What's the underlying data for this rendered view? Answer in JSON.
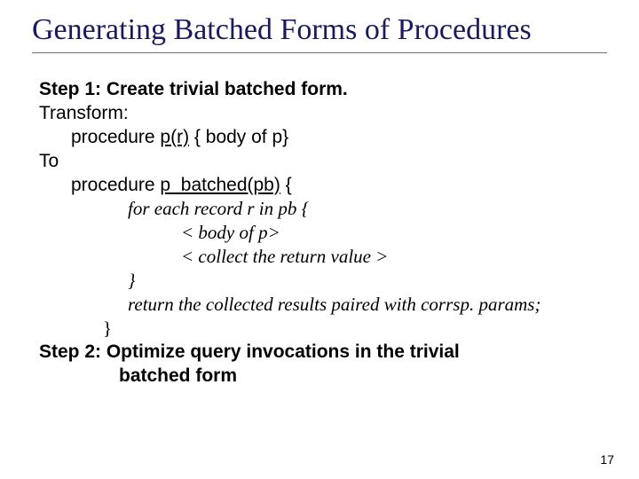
{
  "title": "Generating Batched Forms of Procedures",
  "body": {
    "step1_heading": "Step 1: Create trivial batched form.",
    "transform_label": "Transform:",
    "proc_orig_prefix": "procedure ",
    "proc_orig_sig": "p(r)",
    "proc_orig_suffix": " { body of p}",
    "to_label": "To",
    "proc_batched_prefix": "procedure ",
    "proc_batched_sig": "p_batched(pb)",
    "proc_batched_suffix": " {",
    "foreach_line": "for each record r in pb {",
    "body_of_p_line": "< body of p>",
    "collect_line": "< collect the return value >",
    "close_inner": "}",
    "return_line": "return the collected results paired with corrsp. params;",
    "close_outer": "}",
    "step2_line1": "Step 2: Optimize query invocations in the trivial",
    "step2_line2": "batched form"
  },
  "page_number": "17"
}
